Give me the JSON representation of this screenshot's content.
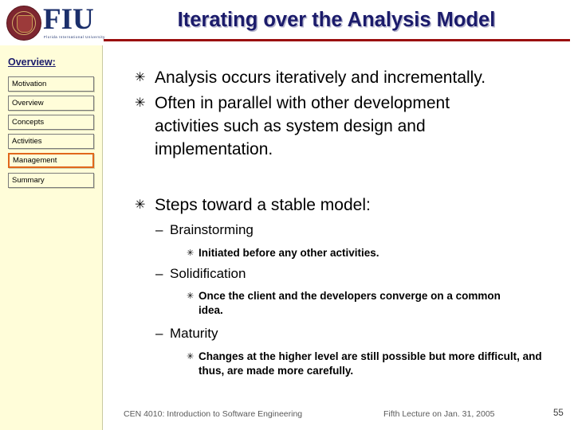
{
  "logo": {
    "institution_abbr": "FIU",
    "institution_full": "Florida International University"
  },
  "header": {
    "title": "Iterating over the Analysis Model"
  },
  "sidebar": {
    "heading": "Overview:",
    "items": [
      {
        "label": "Motivation",
        "active": false
      },
      {
        "label": "Overview",
        "active": false
      },
      {
        "label": "Concepts",
        "active": false
      },
      {
        "label": "Activities",
        "active": false
      },
      {
        "label": "Management",
        "active": true
      },
      {
        "label": "Summary",
        "active": false
      }
    ]
  },
  "content": {
    "bullet_glyph": "✳",
    "dash_glyph": "–",
    "level1": [
      "Analysis occurs iteratively and incrementally.",
      "Often in parallel with other development activities such as system design and implementation.",
      "Steps toward a stable model:"
    ],
    "steps": [
      {
        "label": "Brainstorming",
        "details": [
          "Initiated before any other activities."
        ]
      },
      {
        "label": "Solidification",
        "details": [
          "Once the client and the developers converge on a common idea."
        ]
      },
      {
        "label": "Maturity",
        "details": [
          "Changes at the higher level are still possible but more difficult, and thus, are made more carefully."
        ]
      }
    ]
  },
  "footer": {
    "course": "CEN 4010: Introduction to Software Engineering",
    "lecture": "Fifth Lecture on Jan. 31, 2005",
    "page_number": "55"
  }
}
